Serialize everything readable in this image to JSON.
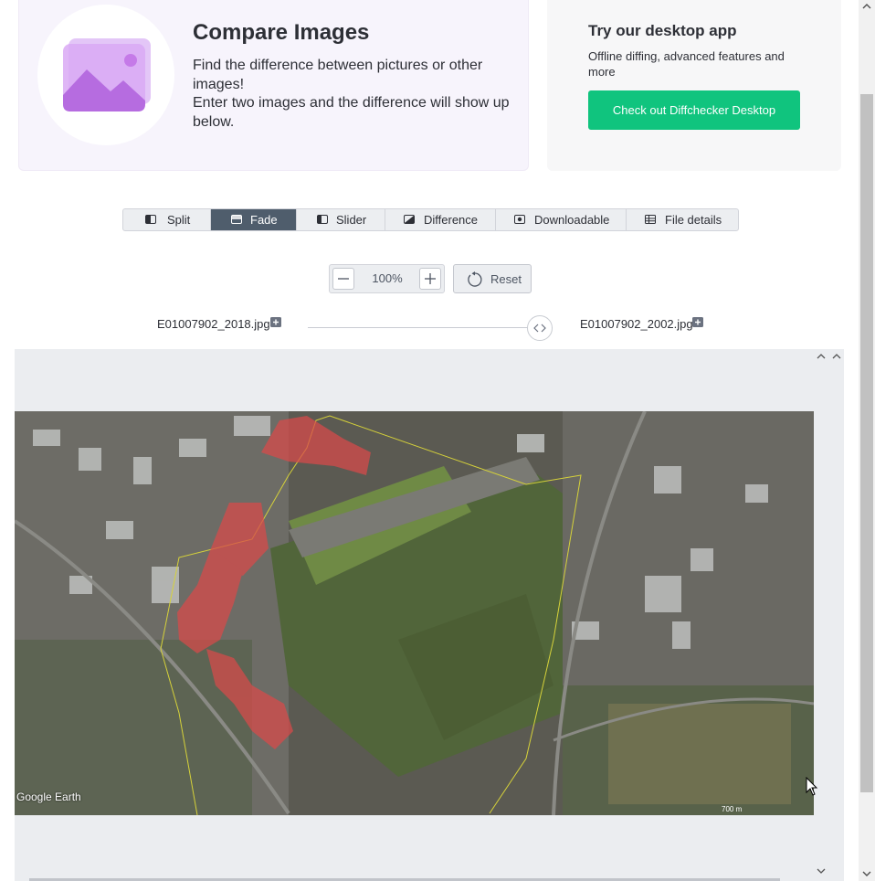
{
  "hero": {
    "title": "Compare Images",
    "desc_line1": "Find the difference between pictures or other images!",
    "desc_line2": "Enter two images and the difference will show up below."
  },
  "promo": {
    "title": "Try our desktop app",
    "desc": "Offline diffing, advanced features and more",
    "button": "Check out Diffchecker Desktop"
  },
  "tabs": [
    {
      "label": "Split",
      "icon": "split-icon"
    },
    {
      "label": "Fade",
      "icon": "fade-icon",
      "active": true
    },
    {
      "label": "Slider",
      "icon": "slider-icon"
    },
    {
      "label": "Difference",
      "icon": "difference-icon"
    },
    {
      "label": "Downloadable",
      "icon": "camera-icon"
    },
    {
      "label": "File details",
      "icon": "table-icon"
    }
  ],
  "zoom": {
    "value": "100%",
    "reset": "Reset"
  },
  "files": {
    "left": "E01007902_2018.jpg",
    "right": "E01007902_2002.jpg"
  },
  "map": {
    "logo": "Google Earth",
    "scale": "700 m"
  },
  "colors": {
    "accent": "#10c47e",
    "active_tab": "#4f5d6c",
    "highlight": "#d94a4a"
  }
}
